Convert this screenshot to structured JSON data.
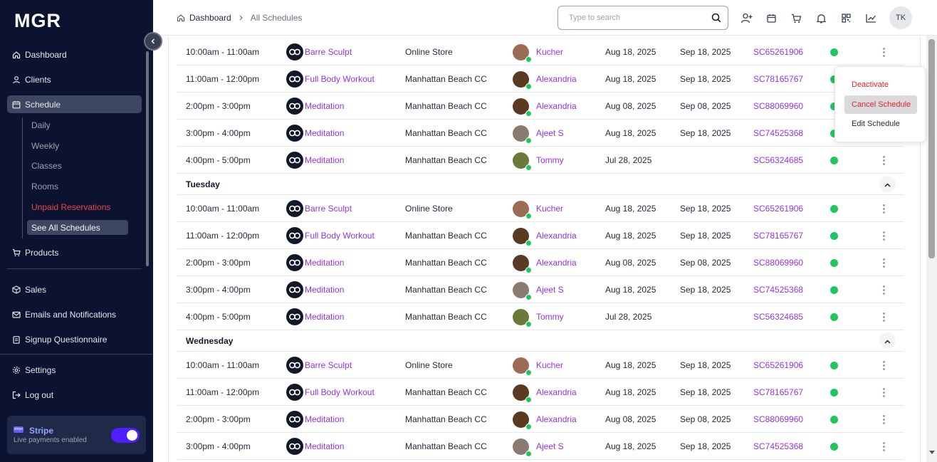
{
  "app": {
    "logo": "MGR"
  },
  "sidebar": {
    "items": [
      {
        "label": "Dashboard",
        "icon": "home-icon"
      },
      {
        "label": "Clients",
        "icon": "user-icon"
      },
      {
        "label": "Schedule",
        "icon": "calendar-icon"
      },
      {
        "label": "Products",
        "icon": "cart-icon"
      },
      {
        "label": "Sales",
        "icon": "box-icon"
      },
      {
        "label": "Emails and Notifications",
        "icon": "mail-icon"
      },
      {
        "label": "Signup Questionnaire",
        "icon": "clipboard-icon"
      },
      {
        "label": "Settings",
        "icon": "gear-icon"
      },
      {
        "label": "Log out",
        "icon": "logout-icon"
      }
    ],
    "schedule_sub": [
      "Daily",
      "Weekly",
      "Classes",
      "Rooms",
      "Unpaid Reservations",
      "See All Schedules"
    ],
    "stripe": {
      "title": "Stripe",
      "subtitle": "Live payments enabled",
      "logo_text": "stripe",
      "enabled": true
    }
  },
  "header": {
    "breadcrumb": {
      "current": "Dashboard",
      "last": "All Schedules"
    },
    "search_placeholder": "Type to search",
    "icons": [
      "add-user-icon",
      "calendar-icon",
      "cart-icon",
      "bell-icon",
      "qr-icon",
      "chart-icon"
    ],
    "avatar_initials": "TK"
  },
  "colors": {
    "sidebar_bg": "#0b1330",
    "accent_purple": "#9333ea",
    "status_green": "#22c55e",
    "danger_red": "#dc2626"
  },
  "dropdown": {
    "items": [
      "Deactivate",
      "Cancel Schedule",
      "Edit Schedule"
    ],
    "highlighted": "Cancel Schedule"
  },
  "schedule": {
    "monday_rows": [
      {
        "time": "10:00am - 11:00am",
        "class": "Barre Sculpt",
        "location": "Online Store",
        "instructor": "Kucher",
        "start": "Aug 18, 2025",
        "end": "Sep 18, 2025",
        "code": "SC65261906"
      },
      {
        "time": "11:00am - 12:00pm",
        "class": "Full Body Workout",
        "location": "Manhattan Beach CC",
        "instructor": "Alexandria",
        "start": "Aug 18, 2025",
        "end": "Sep 18, 2025",
        "code": "SC78165767"
      },
      {
        "time": "2:00pm - 3:00pm",
        "class": "Meditation",
        "location": "Manhattan Beach CC",
        "instructor": "Alexandria",
        "start": "Aug 08, 2025",
        "end": "Sep 08, 2025",
        "code": "SC88069960"
      },
      {
        "time": "3:00pm - 4:00pm",
        "class": "Meditation",
        "location": "Manhattan Beach CC",
        "instructor": "Ajeet S",
        "start": "Aug 18, 2025",
        "end": "Sep 18, 2025",
        "code": "SC74525368"
      },
      {
        "time": "4:00pm - 5:00pm",
        "class": "Meditation",
        "location": "Manhattan Beach CC",
        "instructor": "Tommy",
        "start": "Jul 28, 2025",
        "end": "",
        "code": "SC56324685"
      }
    ],
    "days": [
      {
        "name": "Tuesday",
        "rows": [
          {
            "time": "10:00am - 11:00am",
            "class": "Barre Sculpt",
            "location": "Online Store",
            "instructor": "Kucher",
            "start": "Aug 18, 2025",
            "end": "Sep 18, 2025",
            "code": "SC65261906"
          },
          {
            "time": "11:00am - 12:00pm",
            "class": "Full Body Workout",
            "location": "Manhattan Beach CC",
            "instructor": "Alexandria",
            "start": "Aug 18, 2025",
            "end": "Sep 18, 2025",
            "code": "SC78165767"
          },
          {
            "time": "2:00pm - 3:00pm",
            "class": "Meditation",
            "location": "Manhattan Beach CC",
            "instructor": "Alexandria",
            "start": "Aug 08, 2025",
            "end": "Sep 08, 2025",
            "code": "SC88069960"
          },
          {
            "time": "3:00pm - 4:00pm",
            "class": "Meditation",
            "location": "Manhattan Beach CC",
            "instructor": "Ajeet S",
            "start": "Aug 18, 2025",
            "end": "Sep 18, 2025",
            "code": "SC74525368"
          },
          {
            "time": "4:00pm - 5:00pm",
            "class": "Meditation",
            "location": "Manhattan Beach CC",
            "instructor": "Tommy",
            "start": "Jul 28, 2025",
            "end": "",
            "code": "SC56324685"
          }
        ]
      },
      {
        "name": "Wednesday",
        "rows": [
          {
            "time": "10:00am - 11:00am",
            "class": "Barre Sculpt",
            "location": "Online Store",
            "instructor": "Kucher",
            "start": "Aug 18, 2025",
            "end": "Sep 18, 2025",
            "code": "SC65261906"
          },
          {
            "time": "11:00am - 12:00pm",
            "class": "Full Body Workout",
            "location": "Manhattan Beach CC",
            "instructor": "Alexandria",
            "start": "Aug 18, 2025",
            "end": "Sep 18, 2025",
            "code": "SC78165767"
          },
          {
            "time": "2:00pm - 3:00pm",
            "class": "Meditation",
            "location": "Manhattan Beach CC",
            "instructor": "Alexandria",
            "start": "Aug 08, 2025",
            "end": "Sep 08, 2025",
            "code": "SC88069960"
          },
          {
            "time": "3:00pm - 4:00pm",
            "class": "Meditation",
            "location": "Manhattan Beach CC",
            "instructor": "Ajeet S",
            "start": "Aug 18, 2025",
            "end": "Sep 18, 2025",
            "code": "SC74525368"
          }
        ]
      }
    ]
  }
}
